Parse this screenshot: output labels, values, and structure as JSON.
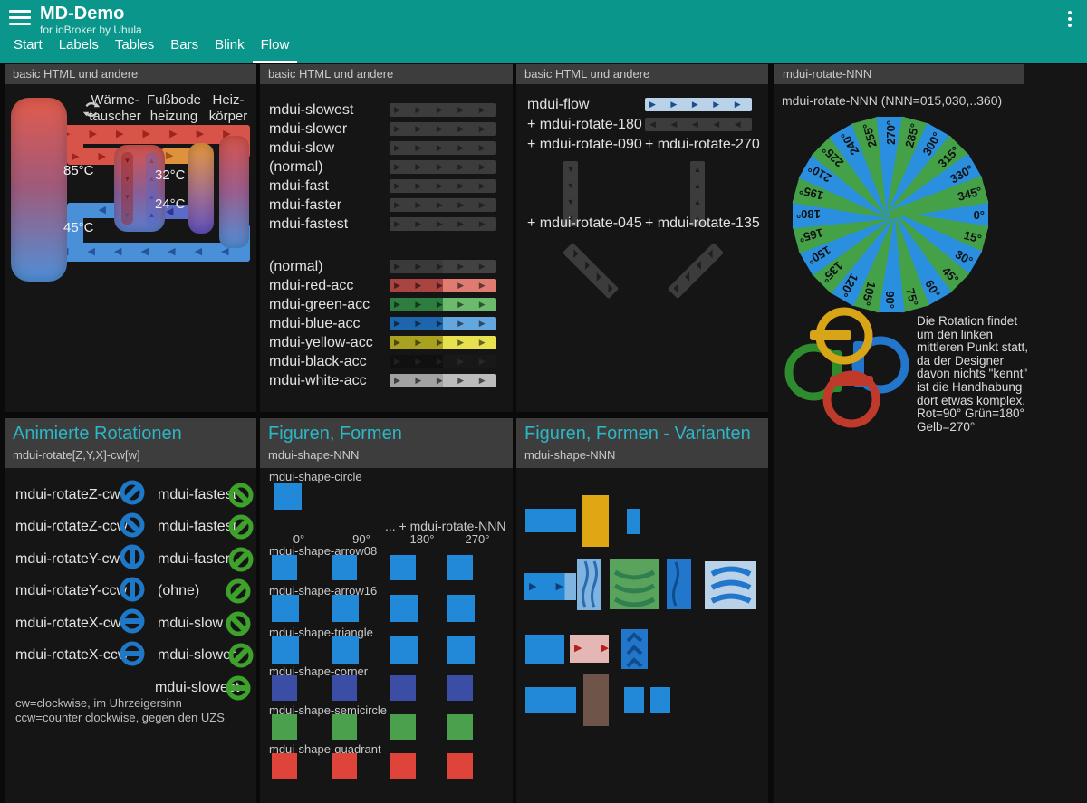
{
  "app": {
    "title": "MD-Demo",
    "subtitle": "for ioBroker by Uhula"
  },
  "tabs": [
    {
      "label": "Start",
      "active": false
    },
    {
      "label": "Labels",
      "active": false
    },
    {
      "label": "Tables",
      "active": false
    },
    {
      "label": "Bars",
      "active": false
    },
    {
      "label": "Blink",
      "active": false
    },
    {
      "label": "Flow",
      "active": true
    }
  ],
  "colors": {
    "appbar": "#0a968b",
    "accent": "#2bb7c5",
    "header_bg": "#3d3d3d",
    "bar_gray": "#3c3c3c",
    "blue": "#2289d8",
    "green": "#44a148",
    "shape_green": "#4aa04d",
    "indigo": "#3b4da5",
    "red": "#de443a",
    "amber": "#dfa714",
    "brown": "#6e5449",
    "pink": "#e4b6b4",
    "light_blue": "#7fb3e0",
    "pale_blue": "#b9d2e8",
    "strong_blue": "#2277cc",
    "flow_chev": "#1c4e8c",
    "icon_blue": "#1e78c8",
    "icon_green": "#3da12c",
    "pipe_red": "#d85348",
    "pipe_blue": "#4a90d8",
    "pipe_orange": "#e0913c",
    "pipe_purple": "#5b6bc8"
  },
  "panels": {
    "diagram": {
      "header": "basic HTML und andere",
      "label1a": "Wärme-",
      "label1b": "tauscher",
      "label2a": "Fußbode",
      "label2b": "heizung",
      "label3a": "Heiz-",
      "label3b": "körper",
      "temp_hot": "85°C",
      "temp_return": "45°C",
      "temp_floor_in": "32°C",
      "temp_floor_out": "24°C"
    },
    "speeds": {
      "header": "basic HTML und andere",
      "rows": [
        "mdui-slowest",
        "mdui-slower",
        "mdui-slow",
        "(normal)",
        "mdui-fast",
        "mdui-faster",
        "mdui-fastest"
      ],
      "acc_rows": [
        {
          "label": "(normal)",
          "left": "#3a3a3a",
          "right": "#424242",
          "chev": "rgba(0,0,0,0.45)"
        },
        {
          "label": "mdui-red-acc",
          "left": "#a94440",
          "right": "#e07b72",
          "chev": "rgba(0,0,0,0.55)"
        },
        {
          "label": "mdui-green-acc",
          "left": "#2d7d41",
          "right": "#6cba6e",
          "chev": "rgba(0,0,0,0.55)"
        },
        {
          "label": "mdui-blue-acc",
          "left": "#1d66ad",
          "right": "#64a6de",
          "chev": "rgba(0,0,0,0.55)"
        },
        {
          "label": "mdui-yellow-acc",
          "left": "#a8a220",
          "right": "#e7e150",
          "chev": "rgba(0,0,0,0.55)"
        },
        {
          "label": "mdui-black-acc",
          "left": "#101010",
          "right": "#181818",
          "chev": "rgba(255,255,255,0.07)"
        },
        {
          "label": "mdui-white-acc",
          "left": "#a2a2a2",
          "right": "#bcbcbc",
          "chev": "rgba(0,0,0,0.6)"
        }
      ]
    },
    "flowdir": {
      "header": "basic HTML und andere",
      "flow_label": "mdui-flow",
      "r180": "+ mdui-rotate-180",
      "r090": "+ mdui-rotate-090",
      "r270": "+ mdui-rotate-270",
      "r045": "+ mdui-rotate-045",
      "r135": "+ mdui-rotate-135"
    },
    "rotate_nnn": {
      "header": "mdui-rotate-NNN",
      "caption": "mdui-rotate-NNN (NNN=015,030,..360)",
      "angles": [
        0,
        15,
        30,
        45,
        60,
        75,
        90,
        105,
        120,
        135,
        150,
        165,
        180,
        195,
        210,
        225,
        240,
        255,
        270,
        285,
        300,
        315,
        330,
        345
      ],
      "note": "Die Rotation findet um den linken mittleren Punkt statt, da der Designer davon nichts \"kennt\" ist die Handhabung dort etwas komplex. Rot=90° Grün=180° Gelb=270°",
      "ring_yellow": "#d8a418",
      "ring_green": "#2e8b2e",
      "ring_blue": "#2277cc",
      "ring_red": "#bf3a2b"
    },
    "rotations": {
      "title": "Animierte Rotationen",
      "subtitle": "mdui-rotate[Z,Y,X]-cw[w]",
      "rows": [
        {
          "left": "mdui-rotateZ-cw",
          "la": 135,
          "right": "mdui-fastest",
          "ra": 45
        },
        {
          "left": "mdui-rotateZ-ccw",
          "la": 45,
          "right": "mdui-fastest",
          "ra": 135
        },
        {
          "left": "mdui-rotateY-cw",
          "la": 90,
          "right": "mdui-faster",
          "ra": 135
        },
        {
          "left": "mdui-rotateY-ccw",
          "la": 90,
          "right": "(ohne)",
          "ra": 135
        },
        {
          "left": "mdui-rotateX-cw",
          "la": 0,
          "right": "mdui-slow",
          "ra": 45
        },
        {
          "left": "mdui-rotateX-ccw",
          "la": 0,
          "right": "mdui-slower",
          "ra": 135
        },
        {
          "left": "",
          "la": 0,
          "right": "mdui-slowest",
          "ra": 0
        }
      ],
      "note1": "cw=clockwise, im Uhrzeigersinn",
      "note2": "ccw=counter clockwise, gegen den UZS"
    },
    "shapes": {
      "title": "Figuren, Formen",
      "subtitle": "mdui-shape-NNN",
      "first_label": "mdui-shape-circle",
      "rotate_caption": "... + mdui-rotate-NNN",
      "columns": [
        "0°",
        "90°",
        "180°",
        "270°"
      ],
      "rows": [
        {
          "label": "mdui-shape-arrow08",
          "color": "#2289d8",
          "size": 28
        },
        {
          "label": "mdui-shape-arrow16",
          "color": "#2289d8",
          "size": 30
        },
        {
          "label": "mdui-shape-triangle",
          "color": "#2289d8",
          "size": 30
        },
        {
          "label": "mdui-shape-corner",
          "color": "#3b4da5",
          "size": 28
        },
        {
          "label": "mdui-shape-semicircle",
          "color": "#4aa04d",
          "size": 28
        },
        {
          "label": "mdui-shape-quadrant",
          "color": "#de443a",
          "size": 28
        }
      ]
    },
    "variants": {
      "title": "Figuren, Formen - Varianten",
      "subtitle": "mdui-shape-NNN"
    }
  }
}
